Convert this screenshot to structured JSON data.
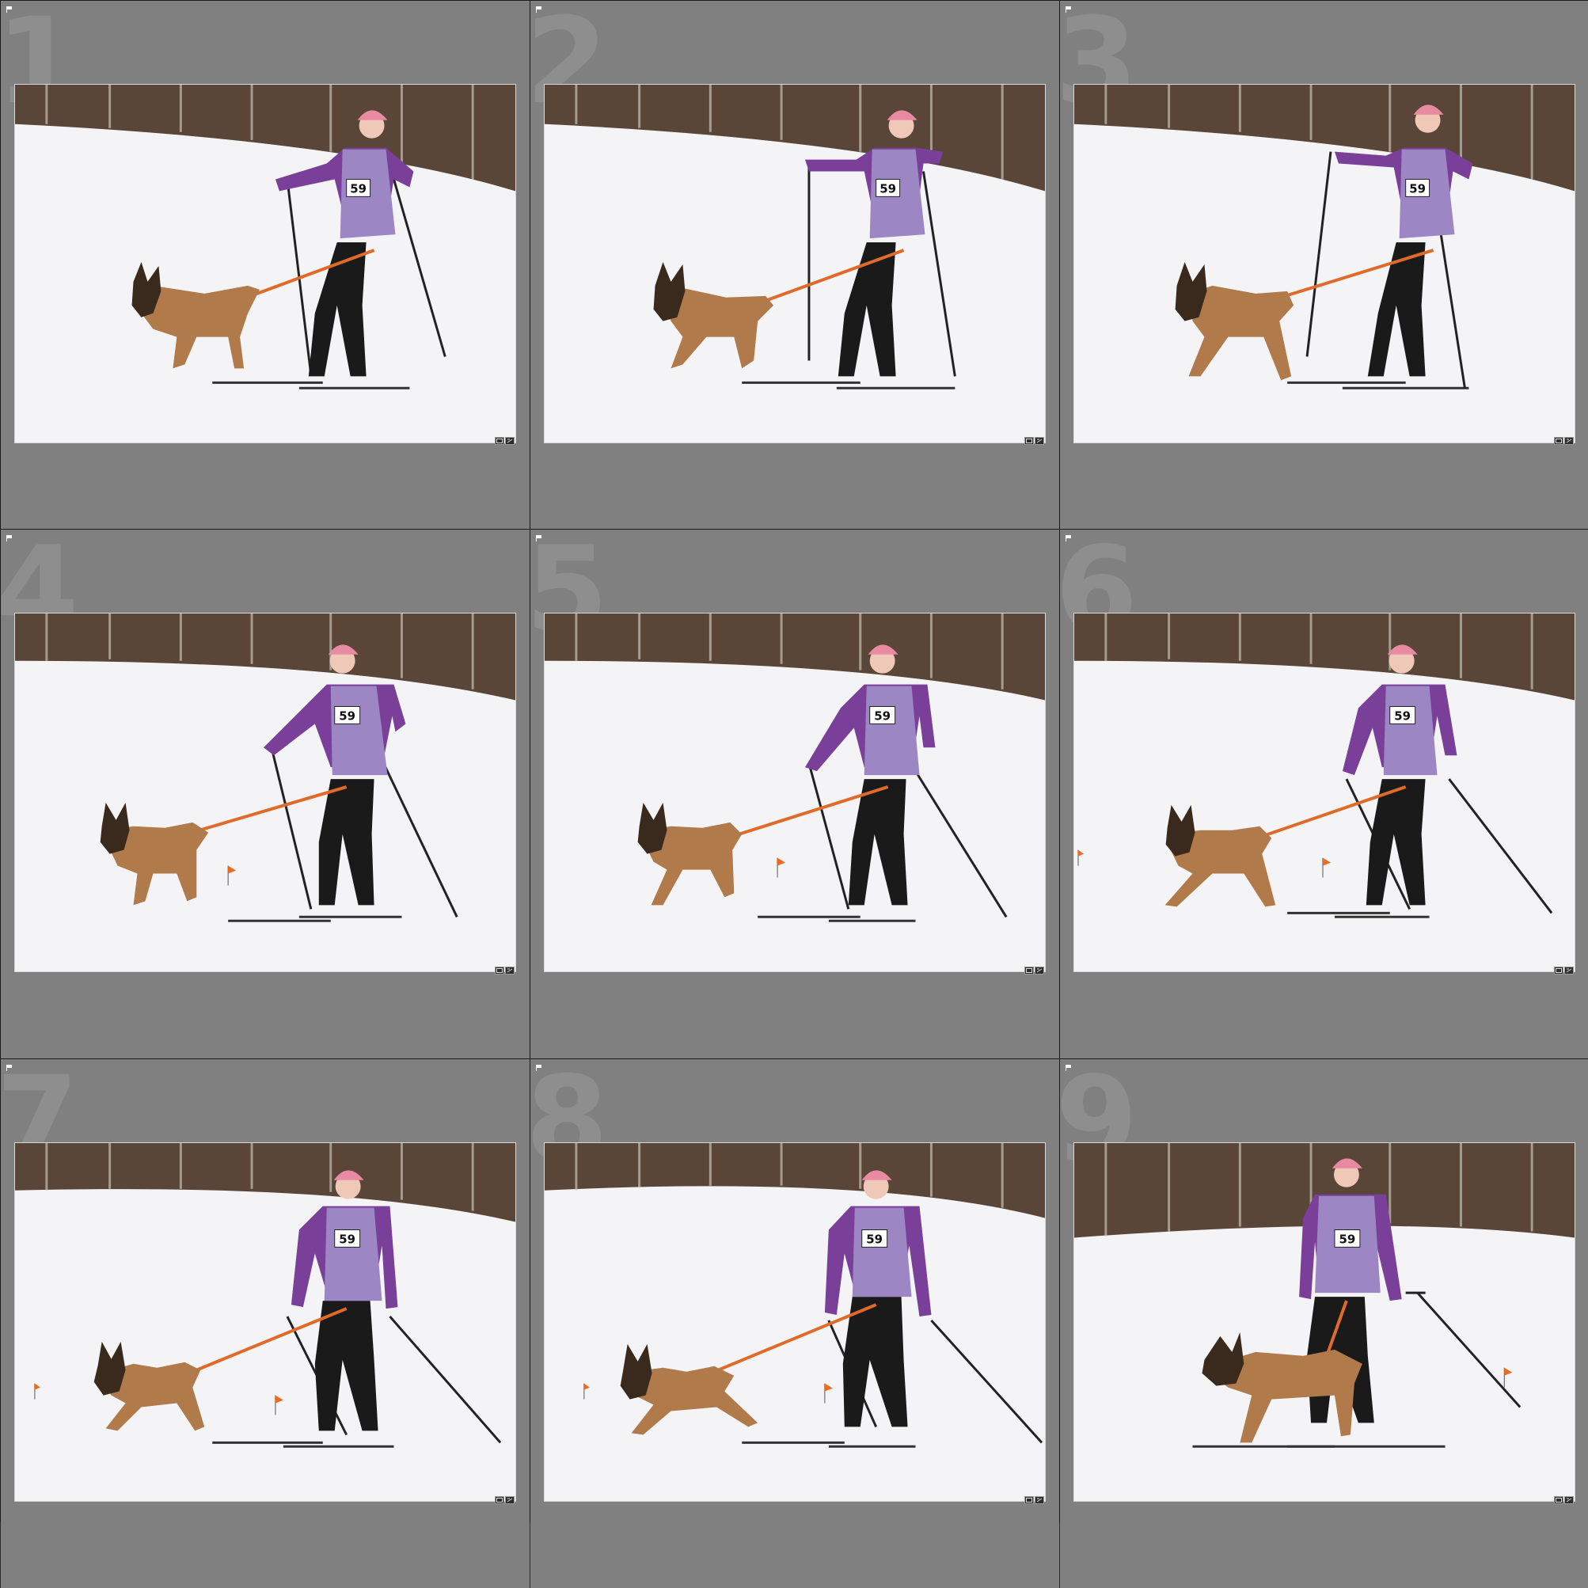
{
  "grid": {
    "cells": [
      {
        "number": "1",
        "bib": "59"
      },
      {
        "number": "2",
        "bib": "59"
      },
      {
        "number": "3",
        "bib": "59"
      },
      {
        "number": "4",
        "bib": "59"
      },
      {
        "number": "5",
        "bib": "59"
      },
      {
        "number": "6",
        "bib": "59"
      },
      {
        "number": "7",
        "bib": "59"
      },
      {
        "number": "8",
        "bib": "59"
      },
      {
        "number": "9",
        "bib": "59"
      }
    ]
  },
  "icons": {
    "flag": "flag-icon",
    "crop_badge": "crop-badge-icon",
    "edit_badge": "develop-settings-badge-icon"
  },
  "colors": {
    "cell_background": "#808080",
    "grid_lines": "#1c1c1c",
    "vest": "#9c86c4",
    "sleeves": "#7a3f98",
    "leash": "#e06a2a",
    "dog": "#b07a4a",
    "trees": "#5a4638",
    "snow": "#f4f4f6"
  }
}
